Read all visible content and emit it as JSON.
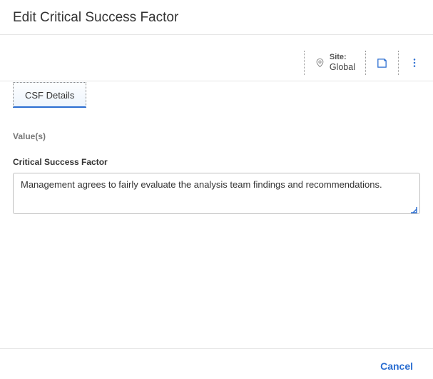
{
  "header": {
    "title": "Edit Critical Success Factor"
  },
  "context": {
    "site_label": "Site:",
    "site_value": "Global"
  },
  "tabs": {
    "active": "CSF Details"
  },
  "form": {
    "section_header": "Value(s)",
    "csf_label": "Critical Success Factor",
    "csf_value": "Management agrees to fairly evaluate the analysis team findings and recommendations."
  },
  "footer": {
    "cancel": "Cancel"
  }
}
